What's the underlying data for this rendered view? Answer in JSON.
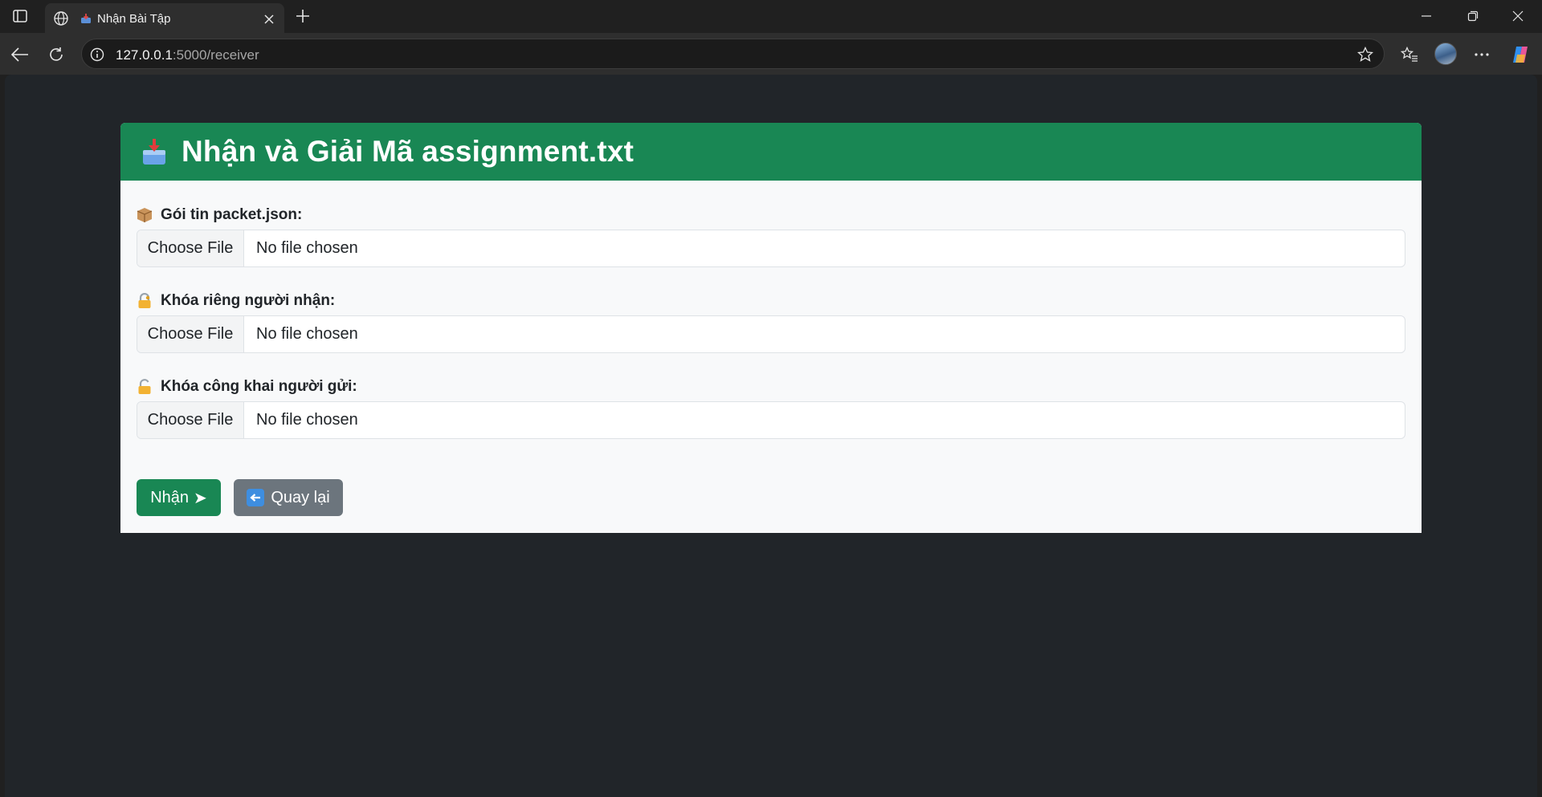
{
  "browser": {
    "tab_title": "Nhận Bài Tập",
    "url_host": "127.0.0.1",
    "url_path": ":5000/receiver"
  },
  "page": {
    "header_title": "Nhận và Giải Mã assignment.txt",
    "fields": [
      {
        "label": "Gói tin packet.json:",
        "icon": "package-icon",
        "button": "Choose File",
        "status": "No file chosen"
      },
      {
        "label": "Khóa riêng người nhận:",
        "icon": "locked-key-icon",
        "button": "Choose File",
        "status": "No file chosen"
      },
      {
        "label": "Khóa công khai người gửi:",
        "icon": "unlocked-icon",
        "button": "Choose File",
        "status": "No file chosen"
      }
    ],
    "submit_label": "Nhận",
    "submit_glyph": "➤",
    "back_label": "Quay lại"
  },
  "colors": {
    "primary_green": "#198754",
    "secondary_gray": "#6c757d",
    "page_bg": "#212529"
  }
}
